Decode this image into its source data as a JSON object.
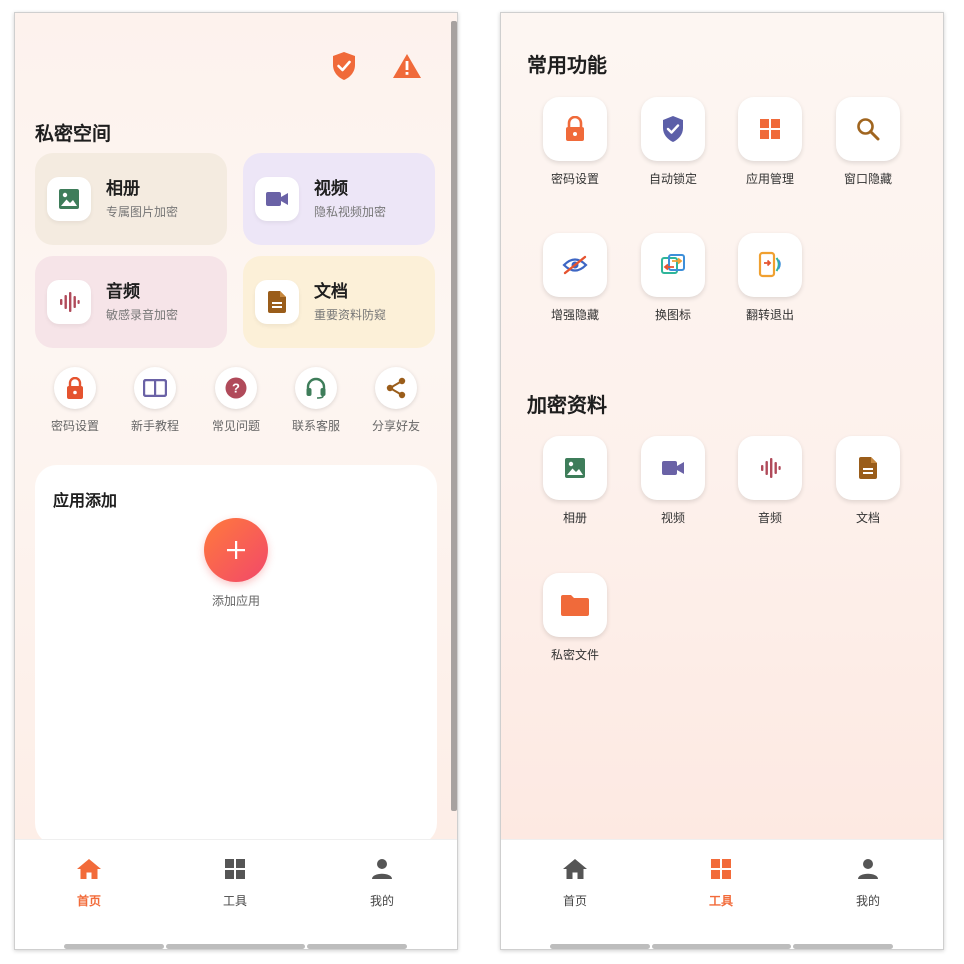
{
  "colors": {
    "accent": "#f26b3a",
    "icon_orange": "#f06a3a",
    "album": "#3e7d5a",
    "video": "#6a62a6",
    "audio": "#b04a5a",
    "doc": "#9a5d1a"
  },
  "home": {
    "section_title": "私密空间",
    "cards": [
      {
        "title": "相册",
        "subtitle": "专属图片加密",
        "icon": "image-icon"
      },
      {
        "title": "视频",
        "subtitle": "隐私视频加密",
        "icon": "video-camera-icon"
      },
      {
        "title": "音频",
        "subtitle": "敏感录音加密",
        "icon": "audio-wave-icon"
      },
      {
        "title": "文档",
        "subtitle": "重要资料防窥",
        "icon": "document-icon"
      }
    ],
    "shortcuts": [
      {
        "label": "密码设置",
        "icon": "lock-icon"
      },
      {
        "label": "新手教程",
        "icon": "book-icon"
      },
      {
        "label": "常见问题",
        "icon": "question-icon"
      },
      {
        "label": "联系客服",
        "icon": "headset-icon"
      },
      {
        "label": "分享好友",
        "icon": "share-icon"
      }
    ],
    "panel_title": "应用添加",
    "add_label": "添加应用"
  },
  "tools": {
    "common_title": "常用功能",
    "common": [
      {
        "label": "密码设置",
        "icon": "lock-icon"
      },
      {
        "label": "自动锁定",
        "icon": "shield-check-icon"
      },
      {
        "label": "应用管理",
        "icon": "grid-icon"
      },
      {
        "label": "窗口隐藏",
        "icon": "search-icon"
      },
      {
        "label": "增强隐藏",
        "icon": "eye-off-icon"
      },
      {
        "label": "换图标",
        "icon": "swap-icon"
      },
      {
        "label": "翻转退出",
        "icon": "phone-flip-icon"
      }
    ],
    "encrypted_title": "加密资料",
    "encrypted": [
      {
        "label": "相册",
        "icon": "image-icon"
      },
      {
        "label": "视频",
        "icon": "video-camera-icon"
      },
      {
        "label": "音频",
        "icon": "audio-wave-icon"
      },
      {
        "label": "文档",
        "icon": "document-icon"
      },
      {
        "label": "私密文件",
        "icon": "folder-icon"
      }
    ]
  },
  "nav": [
    {
      "label": "首页",
      "icon": "home-icon"
    },
    {
      "label": "工具",
      "icon": "grid-icon"
    },
    {
      "label": "我的",
      "icon": "person-icon"
    }
  ],
  "nav_active": {
    "home_screen": "首页",
    "tools_screen": "工具"
  }
}
